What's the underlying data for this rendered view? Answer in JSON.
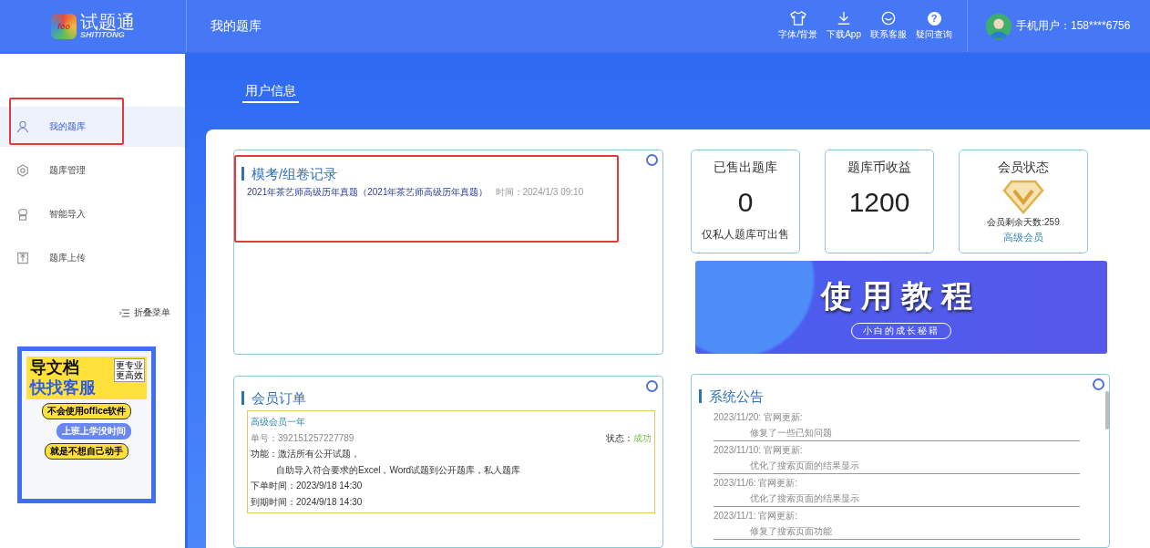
{
  "header": {
    "logo": {
      "badge": "foo",
      "name": "试题通",
      "subtitle": "SHITITONG"
    },
    "title": "我的题库",
    "tools": [
      {
        "label": "字体/背景"
      },
      {
        "label": "下载App"
      },
      {
        "label": "联系客服"
      },
      {
        "label": "疑问查询",
        "glyph": "?"
      }
    ],
    "user": "手机用户：158****6756"
  },
  "sidebar": {
    "items": [
      {
        "label": "我的题库",
        "selected": true
      },
      {
        "label": "题库管理",
        "selected": false
      },
      {
        "label": "智能导入",
        "selected": false
      },
      {
        "label": "题库上传",
        "selected": false
      }
    ],
    "collapse": "折叠菜单",
    "ad": {
      "headline": "导文档",
      "headline2": "快找客服",
      "tag": [
        "更专业",
        "更高效"
      ],
      "pills": [
        "不会使用office软件",
        "上班上学没时间",
        "就是不想自己动手"
      ]
    }
  },
  "tabs": [
    {
      "label": "用户信息",
      "selected": true
    }
  ],
  "exam_records": {
    "title": "模考/组卷记录",
    "items": [
      {
        "name": "2021年茶艺师高级历年真题（2021年茶艺师高级历年真题）",
        "time": "时间：2024/1/3 09:10"
      }
    ]
  },
  "stats": [
    {
      "kind": "number",
      "title": "已售出题库",
      "value": "0",
      "note": "仅私人题库可出售"
    },
    {
      "kind": "number",
      "title": "题库币收益",
      "value": "1200"
    },
    {
      "kind": "membership",
      "title": "会员状态",
      "days": "会员剩余天数:259",
      "tier": "高级会员"
    }
  ],
  "tutorial_banner": {
    "title": "使用教程",
    "subtitle": "小白的成长秘籍"
  },
  "orders": {
    "title": "会员订单",
    "items": [
      {
        "plan": "高级会员一年",
        "number": "单号：392151257227789",
        "status_label": "状态：",
        "status": "成功",
        "features_label": "功能：",
        "features": [
          "激活所有公开试题，",
          "自助导入符合要求的Excel，Word试题到公开题库，私人题库"
        ],
        "ordered": "下单时间：2023/9/18 14:30",
        "expires": "到期时间：2024/9/18 14:30"
      }
    ]
  },
  "notices": {
    "title": "系统公告",
    "items": [
      {
        "date": "2023/11/20: 官网更新:",
        "text": "修复了一些已知问题"
      },
      {
        "date": "2023/11/10: 官网更新:",
        "text": "优化了搜索页面的结果显示"
      },
      {
        "date": "2023/11/6: 官网更新:",
        "text": "优化了搜索页面的结果显示"
      },
      {
        "date": "2023/11/1: 官网更新:",
        "text": "修复了搜索页面功能"
      }
    ]
  }
}
